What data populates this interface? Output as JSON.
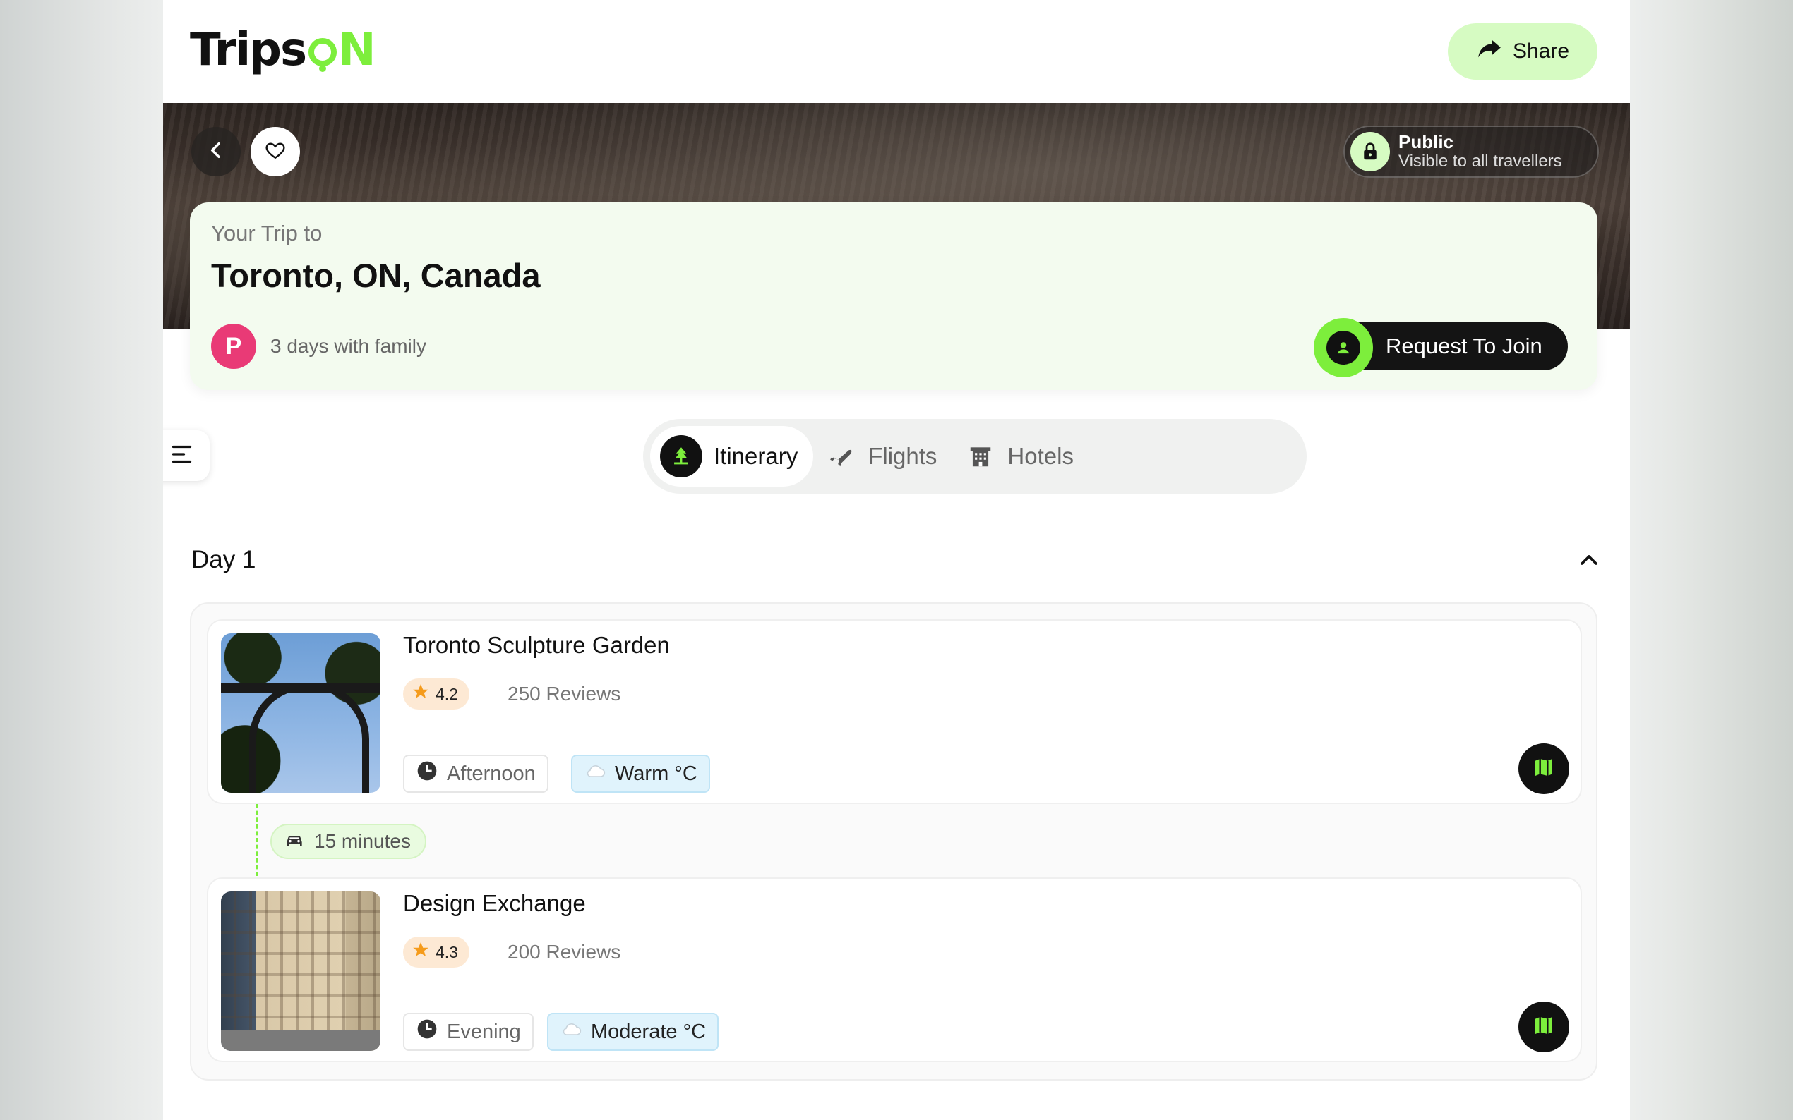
{
  "header": {
    "logo_left": "Trips",
    "logo_right": "N",
    "share_label": "Share"
  },
  "hero": {
    "visibility_title": "Public",
    "visibility_subtitle": "Visible to all travellers"
  },
  "trip": {
    "subtitle": "Your Trip to",
    "destination": "Toronto, ON, Canada",
    "avatar_initial": "P",
    "meta": "3 days with family",
    "join_label": "Request To Join"
  },
  "tabs": [
    {
      "label": "Itinerary",
      "active": true,
      "icon": "tree-pin-icon"
    },
    {
      "label": "Flights",
      "active": false,
      "icon": "plane-icon"
    },
    {
      "label": "Hotels",
      "active": false,
      "icon": "hotel-icon"
    }
  ],
  "day": {
    "title": "Day 1",
    "places": [
      {
        "name": "Toronto Sculpture Garden",
        "rating": "4.2",
        "reviews": "250 Reviews",
        "time": "Afternoon",
        "weather": "Warm °C"
      },
      {
        "name": "Design Exchange",
        "rating": "4.3",
        "reviews": "200 Reviews",
        "time": "Evening",
        "weather": "Moderate °C"
      }
    ],
    "transit": "15 minutes"
  },
  "colors": {
    "accent_green": "#7dee3c",
    "share_bg": "#d6fbc2",
    "avatar_pink": "#e93a76",
    "rating_bg": "#fde9d4",
    "weather_bg": "#e0f3fc"
  }
}
